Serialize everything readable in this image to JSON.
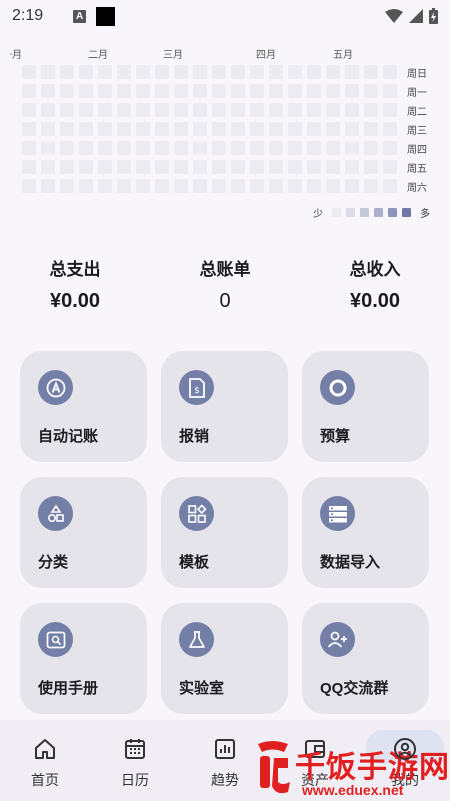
{
  "status_bar": {
    "time": "2:19",
    "a_icon": "A"
  },
  "heatmap": {
    "months": [
      "一月",
      "二月",
      "三月",
      "四月",
      "五月"
    ],
    "weekdays": [
      "周日",
      "周一",
      "周二",
      "周三",
      "周四",
      "周五",
      "周六"
    ],
    "legend": {
      "less": "少",
      "more": "多",
      "levels": [
        "#ecebf1",
        "#dcdde8",
        "#c5c9dc",
        "#aab0cd",
        "#8c95bb",
        "#6c78a6"
      ]
    }
  },
  "totals": {
    "expense": {
      "label": "总支出",
      "value": "¥0.00"
    },
    "bills": {
      "label": "总账单",
      "value": "0"
    },
    "income": {
      "label": "总收入",
      "value": "¥0.00"
    }
  },
  "features": [
    {
      "label": "自动记账",
      "icon": "auto-a-icon"
    },
    {
      "label": "报销",
      "icon": "reimburse-icon"
    },
    {
      "label": "预算",
      "icon": "budget-circle-icon"
    },
    {
      "label": "分类",
      "icon": "category-shapes-icon"
    },
    {
      "label": "模板",
      "icon": "template-grid-icon"
    },
    {
      "label": "数据导入",
      "icon": "data-import-icon"
    },
    {
      "label": "使用手册",
      "icon": "manual-icon"
    },
    {
      "label": "实验室",
      "icon": "lab-flask-icon"
    },
    {
      "label": "QQ交流群",
      "icon": "group-add-icon"
    }
  ],
  "nav": [
    {
      "label": "首页",
      "icon": "home-icon"
    },
    {
      "label": "日历",
      "icon": "calendar-icon"
    },
    {
      "label": "趋势",
      "icon": "chart-icon"
    },
    {
      "label": "资产",
      "icon": "wallet-icon"
    },
    {
      "label": "我的",
      "icon": "profile-icon"
    }
  ],
  "watermark": {
    "text": "千饭手游网",
    "url": "www.eduex.net"
  },
  "colors": {
    "accent": "#737fa6",
    "card_bg": "#e6e4eb",
    "watermark": "#e02020"
  }
}
